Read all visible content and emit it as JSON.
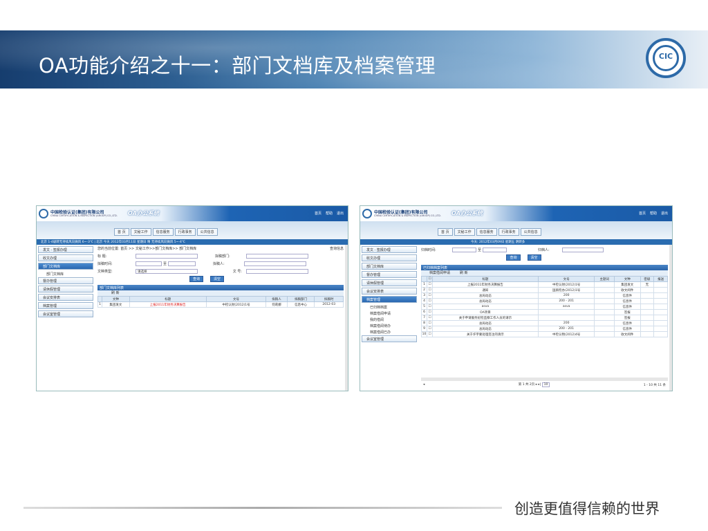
{
  "slide": {
    "title": "OA功能介绍之十一：部门文档库及档案管理",
    "footer": "创造更值得信赖的世界",
    "logo_text": "CIC"
  },
  "app": {
    "company_cn": "中国检验认证(集团)有限公司",
    "company_en": "CHINA CERTIFICATION & INSPECTION (GROUP) CO.,LTD.",
    "system_name": "OA办公系统",
    "header_buttons": [
      "首页",
      "帮助",
      "退出"
    ],
    "nav_tabs": [
      "首 页",
      "文秘工作",
      "信息服务",
      "行政事务",
      "公共信息"
    ]
  },
  "left_shot": {
    "status_bar": "北京 1-4级转无持续风向微风  6~-3℃  |  北京  今天 2012年03月11日 星期日  晴  无持续风向微风  5~-4℃",
    "sidebar": [
      "发文 · 签报办理",
      "收文办理",
      "部门文档库",
      "部门文档库",
      "督办管理",
      "请休假管理",
      "会议安排表",
      "档案管理",
      "会议室管理"
    ],
    "crumb": "您的当前位置: 首页 >> 文秘工作>>部门文档库>> 部门文档库",
    "query_info": "查询信息",
    "form": {
      "title_label": "标  题:",
      "dept_label": "拟稿部门:",
      "date_label": "拟稿时间:",
      "date_sep": "至",
      "drafter_label": "拟稿人:",
      "type_label": "文种类型:",
      "type_value": "请选择",
      "number_label": "文  号:",
      "search_btn": "查询",
      "clear_btn": "清空"
    },
    "list_title": "部门文档库列表",
    "list_tab": "刷 新",
    "columns": [
      "文种",
      "标题",
      "文号",
      "拟稿人",
      "拟稿部门",
      "拟稿时"
    ],
    "rows": [
      [
        "1",
        "集团发文",
        "上报2011年财务决算报告",
        "中检认财(2012)1号",
        "何莉娜",
        "信息中心",
        "2012-03"
      ]
    ]
  },
  "right_shot": {
    "status_bar": "今天: 2012年03月09日 星期五 阴转多",
    "sidebar": [
      "发文 · 签报办理",
      "收文办理",
      "部门文档库",
      "督办管理",
      "请休假管理",
      "会议安排表",
      "档案管理",
      "已归档档案",
      "档案借阅申请",
      "我的借阅",
      "档案借阅待办",
      "档案借阅已办",
      "会议室管理"
    ],
    "form": {
      "date_label": "归档时间:",
      "date_sep": "至",
      "person_label": "归档人:",
      "search_btn": "查询",
      "clear_btn": "清空"
    },
    "list_title": "已归档档案列表",
    "list_tabs": [
      "档案借阅申请",
      "刷 新"
    ],
    "columns": [
      "标题",
      "文号",
      "主题词",
      "文种",
      "密级",
      "报送"
    ],
    "rows": [
      [
        "1",
        "上报2011年财务决算报告",
        "中检认财(2012)1号",
        "",
        "集团发文",
        "无"
      ],
      [
        "2",
        "通知",
        "国质检办(2012)1号",
        "",
        "收文阅件",
        ""
      ],
      [
        "3",
        "总局动态",
        "200",
        "",
        "信息件",
        ""
      ],
      [
        "4",
        "总局动态",
        "200 - 201",
        "",
        "信息件",
        ""
      ],
      [
        "5",
        "asva",
        "asva",
        "",
        "信息件",
        ""
      ],
      [
        "6",
        "OA项目",
        "",
        "",
        "签报",
        ""
      ],
      [
        "7",
        "关于申请服务纪检监察工作人员的请示",
        "",
        "",
        "签报",
        ""
      ],
      [
        "8",
        "总局动态",
        "200",
        "",
        "信息件",
        ""
      ],
      [
        "9",
        "总局动态",
        "200 - 201",
        "",
        "信息件",
        ""
      ],
      [
        "10",
        "关于许宇蒙处理签注的请示",
        "中检认物(2012)4号",
        "",
        "收文阅件",
        ""
      ]
    ],
    "pager": "第 1 共 2页",
    "pager_size": "10",
    "pager_info": "1 - 10  共 11 条"
  }
}
